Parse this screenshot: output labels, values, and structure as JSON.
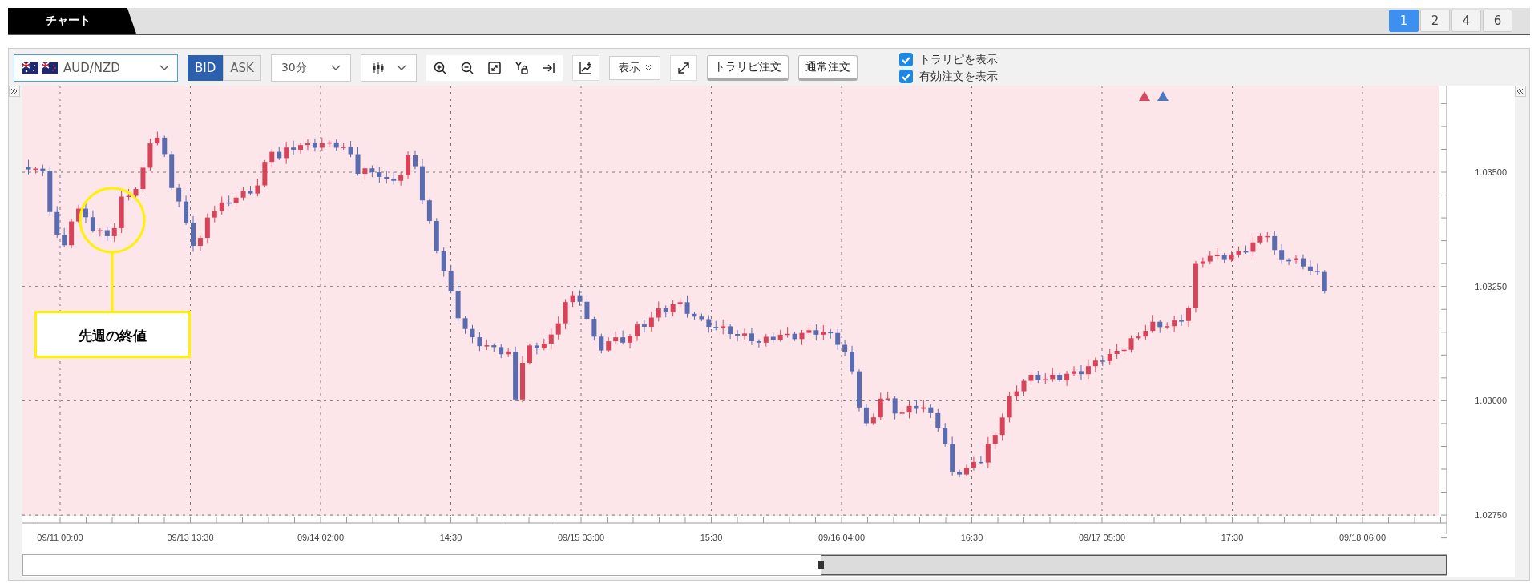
{
  "tab_bar": {
    "title": "チャート",
    "layouts": [
      {
        "label": "1",
        "selected": true
      },
      {
        "label": "2",
        "selected": false
      },
      {
        "label": "4",
        "selected": false
      },
      {
        "label": "6",
        "selected": false
      }
    ]
  },
  "toolbar": {
    "symbol": "AUD/NZD",
    "price_sides": [
      {
        "label": "BID",
        "selected": true
      },
      {
        "label": "ASK",
        "selected": false
      }
    ],
    "timeframe": "30分",
    "display_menu": "表示",
    "buttons": [
      "トラリピ注文",
      "通常注文"
    ],
    "options": [
      {
        "label": "トラリピを表示",
        "checked": true
      },
      {
        "label": "有効注文を表示",
        "checked": true
      }
    ]
  },
  "chart": {
    "price_labels": [
      "1.03500",
      "1.03250",
      "1.03000",
      "1.02750"
    ],
    "time_labels": [
      "09/11 00:00",
      "09/13 13:30",
      "09/14 02:00",
      "14:30",
      "09/15 03:00",
      "15:30",
      "09/16 04:00",
      "16:30",
      "09/17 05:00",
      "17:30",
      "09/18 06:00"
    ],
    "annotation": "先週の終値"
  }
}
